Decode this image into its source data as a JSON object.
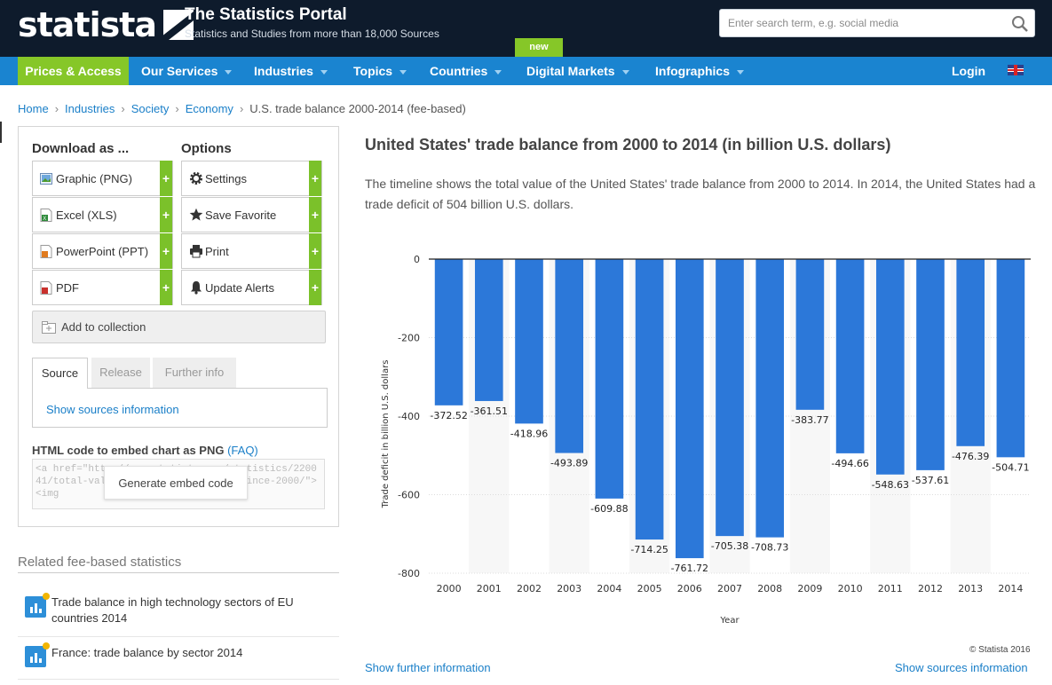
{
  "header": {
    "logo": "statista",
    "title": "The Statistics Portal",
    "subtitle": "Statistics and Studies from more than 18,000 Sources",
    "search_placeholder": "Enter search term, e.g. social media",
    "new_badge": "new"
  },
  "nav": {
    "items": [
      "Prices & Access",
      "Our Services",
      "Industries",
      "Topics",
      "Countries",
      "Digital Markets",
      "Infographics"
    ],
    "login": "Login",
    "accent_color": "#86c728",
    "bar_color": "#1a84d0"
  },
  "breadcrumb": {
    "items": [
      "Home",
      "Industries",
      "Society",
      "Economy"
    ],
    "current": "U.S. trade balance 2000-2014 (fee-based)"
  },
  "left_panel": {
    "download_title": "Download as ...",
    "options_title": "Options",
    "downloads": [
      "Graphic (PNG)",
      "Excel (XLS)",
      "PowerPoint (PPT)",
      "PDF"
    ],
    "options": [
      "Settings",
      "Save Favorite",
      "Print",
      "Update Alerts"
    ],
    "add_collection": "Add to collection",
    "tabs": [
      "Source",
      "Release",
      "Further info"
    ],
    "show_sources": "Show sources information",
    "embed_title": "HTML code to embed chart as PNG",
    "embed_faq": "(FAQ)",
    "embed_code": "<a href=\"http://www.statista.com/statistics/220041/total-value-of-us-trade-balance-since-2000/\"><img",
    "embed_button": "Generate embed code"
  },
  "related": {
    "title": "Related fee-based statistics",
    "items": [
      "Trade balance in high technology sectors of EU countries 2014",
      "France: trade balance by sector 2014"
    ]
  },
  "main": {
    "title": "United States' trade balance from 2000 to 2014 (in billion U.S. dollars)",
    "description": "The timeline shows the total value of the United States' trade balance from 2000 to 2014. In 2014, the United States had a trade deficit of 504 billion U.S. dollars.",
    "copyright": "© Statista 2016",
    "show_further": "Show further information",
    "show_sources": "Show sources information"
  },
  "chart_data": {
    "type": "bar",
    "categories": [
      "2000",
      "2001",
      "2002",
      "2003",
      "2004",
      "2005",
      "2006",
      "2007",
      "2008",
      "2009",
      "2010",
      "2011",
      "2012",
      "2013",
      "2014"
    ],
    "values": [
      -372.52,
      -361.51,
      -418.96,
      -493.89,
      -609.88,
      -714.25,
      -761.72,
      -705.38,
      -708.73,
      -383.77,
      -494.66,
      -548.63,
      -537.61,
      -476.39,
      -504.71
    ],
    "value_labels": [
      "-372.52",
      "-361.51",
      "-418.96",
      "-493.89",
      "-609.88",
      "-714.25",
      "-761.72",
      "-705.38",
      "-708.73",
      "-383.77",
      "-494.66",
      "-548.63",
      "-537.61",
      "-476.39",
      "-504.71"
    ],
    "xlabel": "Year",
    "ylabel": "Trade deficit in billion U.S. dollars",
    "ylim": [
      -800,
      0
    ],
    "yticks": [
      0,
      -200,
      -400,
      -600,
      -800
    ],
    "grid": true,
    "bar_color": "#2c78d9"
  }
}
